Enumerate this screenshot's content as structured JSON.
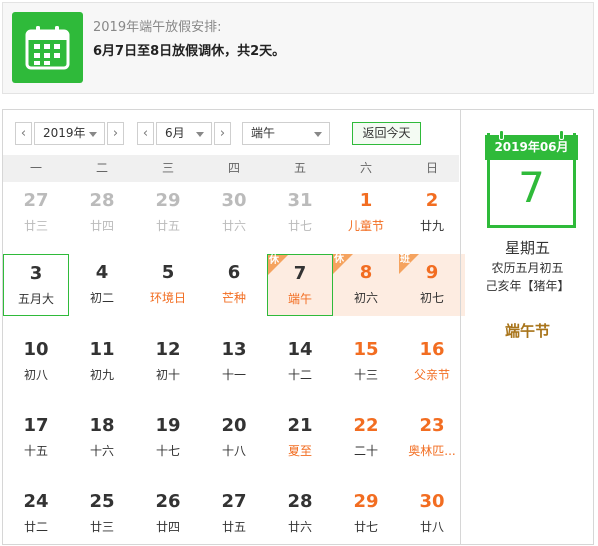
{
  "notice": {
    "title": "2019年端午放假安排:",
    "body": "6月7日至8日放假调休，共2天。"
  },
  "toolbar": {
    "prev": "‹",
    "next": "›",
    "year": "2019年",
    "month": "6月",
    "holiday": "端午",
    "today_button": "返回今天"
  },
  "weekdays": [
    "一",
    "二",
    "三",
    "四",
    "五",
    "六",
    "日"
  ],
  "weeks": [
    [
      {
        "num": "27",
        "sub": "廿三",
        "other": true
      },
      {
        "num": "28",
        "sub": "廿四",
        "other": true
      },
      {
        "num": "29",
        "sub": "廿五",
        "other": true
      },
      {
        "num": "30",
        "sub": "廿六",
        "other": true
      },
      {
        "num": "31",
        "sub": "廿七",
        "other": true
      },
      {
        "num": "1",
        "sub": "儿童节",
        "weekend": true,
        "fest": true
      },
      {
        "num": "2",
        "sub": "廿九",
        "weekend": true
      }
    ],
    [
      {
        "num": "3",
        "sub": "五月大",
        "selected": true
      },
      {
        "num": "4",
        "sub": "初二"
      },
      {
        "num": "5",
        "sub": "环境日",
        "fest": true
      },
      {
        "num": "6",
        "sub": "芒种",
        "fest": true
      },
      {
        "num": "7",
        "sub": "端午",
        "fest": true,
        "today": true,
        "badge": "休"
      },
      {
        "num": "8",
        "sub": "初六",
        "weekend": true,
        "rest": true,
        "badge": "休"
      },
      {
        "num": "9",
        "sub": "初七",
        "weekend": true,
        "rest": true,
        "badge": "班"
      }
    ],
    [
      {
        "num": "10",
        "sub": "初八"
      },
      {
        "num": "11",
        "sub": "初九"
      },
      {
        "num": "12",
        "sub": "初十"
      },
      {
        "num": "13",
        "sub": "十一"
      },
      {
        "num": "14",
        "sub": "十二"
      },
      {
        "num": "15",
        "sub": "十三",
        "weekend": true
      },
      {
        "num": "16",
        "sub": "父亲节",
        "weekend": true,
        "fest": true
      }
    ],
    [
      {
        "num": "17",
        "sub": "十五"
      },
      {
        "num": "18",
        "sub": "十六"
      },
      {
        "num": "19",
        "sub": "十七"
      },
      {
        "num": "20",
        "sub": "十八"
      },
      {
        "num": "21",
        "sub": "夏至",
        "fest": true
      },
      {
        "num": "22",
        "sub": "二十",
        "weekend": true
      },
      {
        "num": "23",
        "sub": "奥林匹...",
        "weekend": true,
        "fest": true
      }
    ],
    [
      {
        "num": "24",
        "sub": "廿二"
      },
      {
        "num": "25",
        "sub": "廿三"
      },
      {
        "num": "26",
        "sub": "廿四"
      },
      {
        "num": "27",
        "sub": "廿五"
      },
      {
        "num": "28",
        "sub": "廿六"
      },
      {
        "num": "29",
        "sub": "廿七",
        "weekend": true
      },
      {
        "num": "30",
        "sub": "廿八",
        "weekend": true
      }
    ]
  ],
  "side": {
    "header": "2019年06月",
    "day": "7",
    "weekday": "星期五",
    "lunar": "农历五月初五",
    "ganzhi": "己亥年【猪年】",
    "festival": "端午节"
  },
  "colors": {
    "accent": "#2fba3a",
    "holiday": "#f26d21",
    "rest_bg": "#fdece1",
    "festival_text": "#a8741a"
  },
  "icons": {
    "notice": "calendar-icon",
    "caret": "chevron-down-icon"
  }
}
